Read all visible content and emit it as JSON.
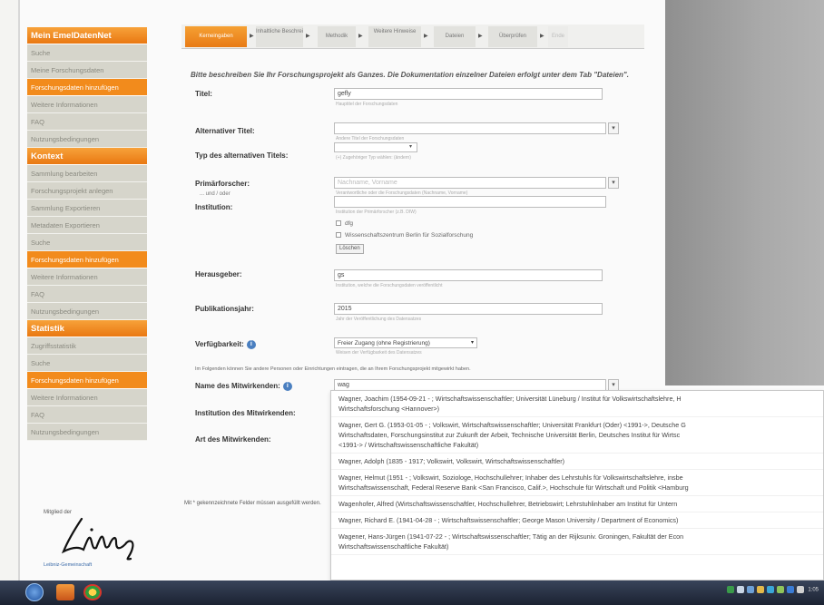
{
  "sidebar": {
    "items": [
      {
        "label": "Mein EmelDatenNet",
        "kind": "head"
      },
      {
        "label": "Suche",
        "kind": "item"
      },
      {
        "label": "Meine Forschungsdaten",
        "kind": "item"
      },
      {
        "label": "Forschungsdaten hinzufügen",
        "kind": "orange"
      },
      {
        "label": "Weitere Informationen",
        "kind": "item"
      },
      {
        "label": "FAQ",
        "kind": "item"
      },
      {
        "label": "Nutzungsbedingungen",
        "kind": "item"
      },
      {
        "label": "Kontext",
        "kind": "head"
      },
      {
        "label": "Sammlung bearbeiten",
        "kind": "item"
      },
      {
        "label": "Forschungsprojekt anlegen",
        "kind": "item"
      },
      {
        "label": "Sammlung Exportieren",
        "kind": "item"
      },
      {
        "label": "Metadaten Exportieren",
        "kind": "item"
      },
      {
        "label": "Suche",
        "kind": "item"
      },
      {
        "label": "Forschungsdaten hinzufügen",
        "kind": "orange"
      },
      {
        "label": "Weitere Informationen",
        "kind": "item"
      },
      {
        "label": "FAQ",
        "kind": "item"
      },
      {
        "label": "Nutzungsbedingungen",
        "kind": "item"
      },
      {
        "label": "Statistik",
        "kind": "head"
      },
      {
        "label": "Zugriffsstatistik",
        "kind": "item"
      },
      {
        "label": "Suche",
        "kind": "item"
      },
      {
        "label": "Forschungsdaten hinzufügen",
        "kind": "orange"
      },
      {
        "label": "Weitere Informationen",
        "kind": "item"
      },
      {
        "label": "FAQ",
        "kind": "item"
      },
      {
        "label": "Nutzungsbedingungen",
        "kind": "item"
      }
    ]
  },
  "logo": {
    "top": "Mitglied der",
    "bottom": "Leibniz-Gemeinschaft"
  },
  "steps": [
    {
      "label": "Kerneingaben",
      "state": "active"
    },
    {
      "label": "Inhaltliche Beschreibung",
      "state": "normal"
    },
    {
      "label": "Methodik",
      "state": "normal"
    },
    {
      "label": "Weitere Hinweise",
      "state": "normal"
    },
    {
      "label": "Dateien",
      "state": "normal"
    },
    {
      "label": "Überprüfen",
      "state": "normal"
    },
    {
      "label": "Ende",
      "state": "disabled"
    }
  ],
  "intro": "Bitte beschreiben Sie Ihr Forschungsprojekt als Ganzes. Die Dokumentation einzelner Dateien erfolgt unter dem Tab \"Dateien\".",
  "form": {
    "title": {
      "label": "Titel:",
      "value": "gefly",
      "hint": "Hauptitel der Forschungsdaten"
    },
    "alt_title": {
      "label": "Alternativer Titel:",
      "value": "",
      "hint": "Andere Titel der Forschungsdaten"
    },
    "alt_type": {
      "label": "Typ des alternativen Titels:",
      "value": "",
      "hint": "(+) Zugehöriger Typ wählen: (ändern)"
    },
    "pi": {
      "label": "Primärforscher:",
      "placeholder": "Nachname, Vorname",
      "hint": "Verantwortliche oder die Forschungsdaten (Nachname, Vorname)"
    },
    "or_label": "... und / oder",
    "institution": {
      "label": "Institution:",
      "value": "",
      "hint": "Institution der Primärforscher (z.B. DIW)"
    },
    "inst_options": [
      "dfg",
      "Wissenschaftszentrum Berlin für Sozialforschung"
    ],
    "delete_label": "Löschen",
    "publisher": {
      "label": "Herausgeber:",
      "value": "gs",
      "hint": "Institution, welche die Forschungsdaten veröffentlicht"
    },
    "year": {
      "label": "Publikationsjahr:",
      "value": "2015",
      "hint": "Jahr der Veröffentlichung des Datensatzes"
    },
    "availability": {
      "label": "Verfügbarkeit:",
      "value": "Freier Zugang (ohne Registrierung)",
      "hint": "Weisen der Verfügbarkeit des Datensatzes"
    },
    "note": "Im Folgenden können Sie andere Personen oder Einrichtungen eintragen, die an Ihrem Forschungsprojekt mitgewirkt haben.",
    "collab_name": {
      "label": "Name des Mitwirkenden:",
      "value": "wag"
    },
    "collab_inst": {
      "label": "Institution des Mitwirkenden:"
    },
    "collab_type": {
      "label": "Art des Mitwirkenden:"
    },
    "required_note": "Mit * gekennzeichnete Felder müssen ausgefüllt werden."
  },
  "autocomplete": [
    [
      "Wagner, Joachim (1954-09-21 - ; Wirtschaftswissenschaftler; Universität Lüneburg / Institut für Volkswirtschaftslehre, H",
      "Wirtschaftsforschung <Hannover>)"
    ],
    [
      "Wagner, Gert G. (1953-01-05 - ; Volkswirt, Wirtschaftswissenschaftler; Universität Frankfurt (Oder) <1991->, Deutsche G",
      "Wirtschaftsdaten, Forschungsinstitut zur Zukunft der Arbeit, Technische Universität Berlin, Deutsches Institut für Wirtsc",
      "<1991-> / Wirtschaftswissenschaftliche Fakultät)"
    ],
    [
      "Wagner, Adolph (1835 - 1917; Volkswirt, Volkswirt, Wirtschaftswissenschaftler)"
    ],
    [
      "Wagner, Helmut (1951 - ; Volkswirt, Soziologe, Hochschullehrer; Inhaber des Lehrstuhls für Volkswirtschaftslehre, insbe",
      "Wirtschaftswissenschaft, Federal Reserve Bank <San Francisco, Calif.>, Hochschule für Wirtschaft und Politik <Hamburg"
    ],
    [
      "Wagenhofer, Alfred (Wirtschaftswissenschaftler, Hochschullehrer, Betriebswirt; Lehrstuhlinhaber am Institut für Untern"
    ],
    [
      "Wagner, Richard E. (1941-04-28 - ; Wirtschaftswissenschaftler; George Mason University / Department of Economics)"
    ],
    [
      "Wagener, Hans-Jürgen (1941-07-22 - ; Wirtschaftswissenschaftler; Tätig an der Rijksuniv. Groningen, Fakultät der Econ",
      "Wirtschaftswissenschaftliche Fakultät)"
    ]
  ],
  "taskbar": {
    "clock": "1:05"
  }
}
